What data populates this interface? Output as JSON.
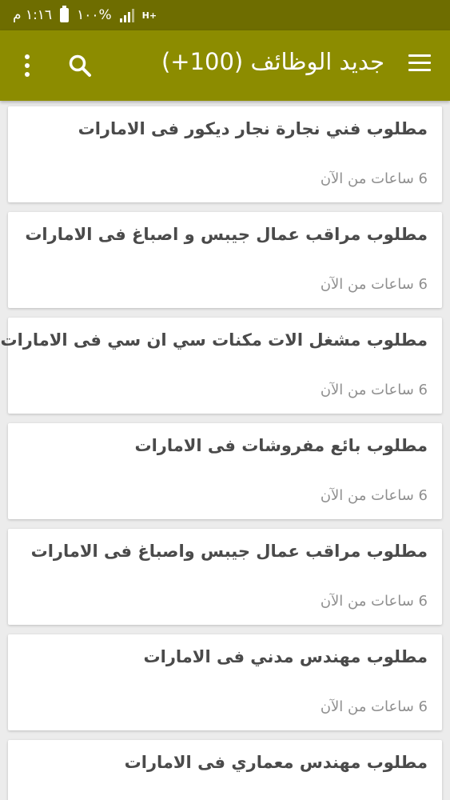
{
  "status_bar": {
    "time": "١:١٦ م",
    "battery": "١٠٠%",
    "network": "H+"
  },
  "app_bar": {
    "title": "جديد الوظائف (100+)"
  },
  "jobs": [
    {
      "title": "مطلوب فني نجارة  نجار ديكور  فى الامارات",
      "time": "6 ساعات من الآن"
    },
    {
      "title": "مطلوب مراقب عمال  جيبس و اصباغ  فى الامارات",
      "time": "6 ساعات من الآن"
    },
    {
      "title": "مطلوب مشغل الات  مكنات سي ان سي  فى الامارات",
      "time": "6 ساعات من الآن"
    },
    {
      "title": "مطلوب بائع  مفروشات  فى الامارات",
      "time": "6 ساعات من الآن"
    },
    {
      "title": "مطلوب مراقب عمال  جيبس واصباغ  فى الامارات",
      "time": "6 ساعات من الآن"
    },
    {
      "title": "مطلوب مهندس مدني   فى الامارات",
      "time": "6 ساعات من الآن"
    },
    {
      "title": "مطلوب مهندس معماري   فى الامارات",
      "time": ""
    }
  ]
}
